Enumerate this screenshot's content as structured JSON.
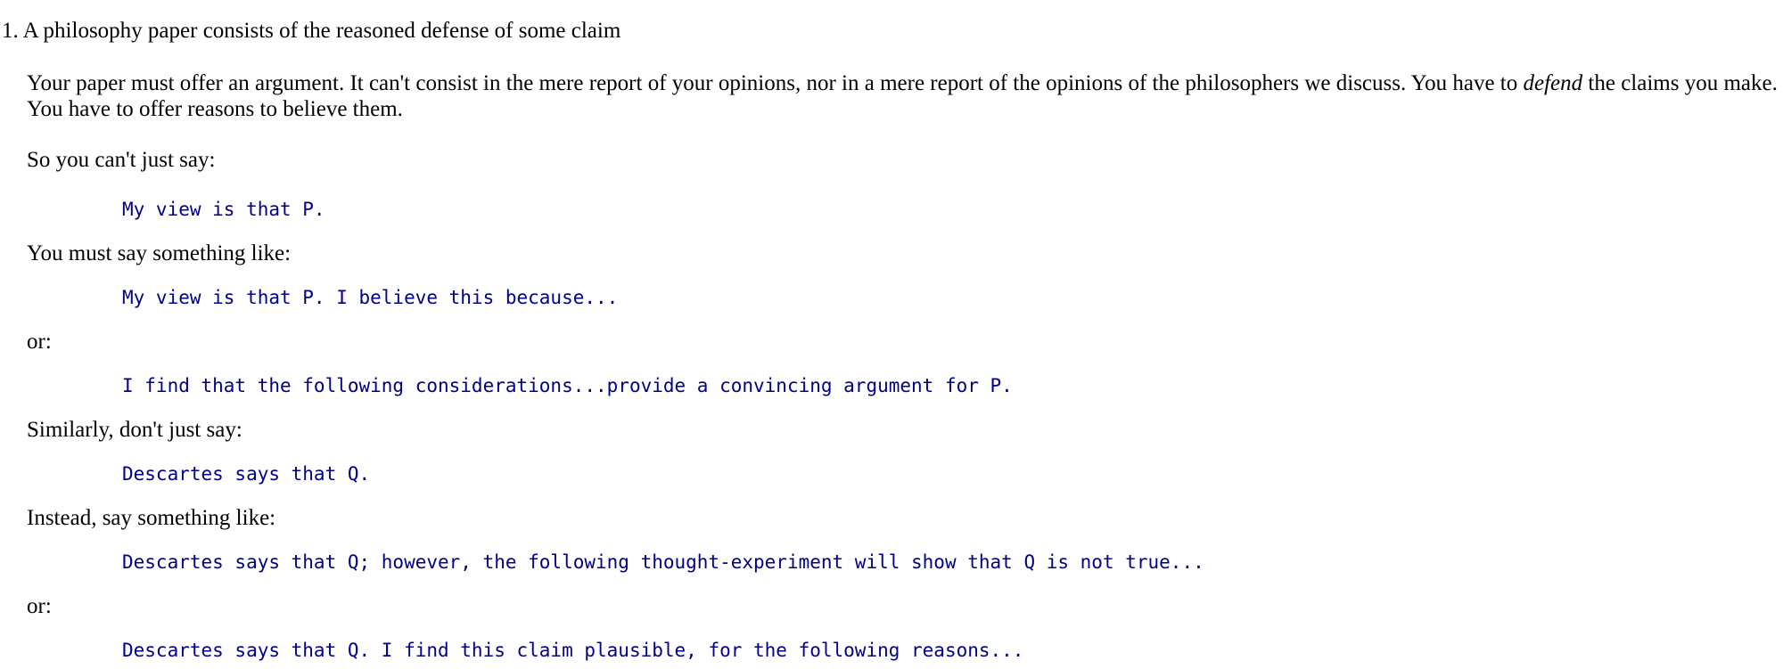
{
  "item": {
    "number": "1.",
    "title": "A philosophy paper consists of the reasoned defense of some claim"
  },
  "intro": {
    "part1": "Your paper must offer an argument. It can't consist in the mere report of your opinions, nor in a mere report of the opinions of the philosophers we discuss. You have to ",
    "emphasis": "defend",
    "part2": " the claims you make. You have to offer reasons to believe them."
  },
  "lines": {
    "cant_say": "So you can't just say:",
    "example1": "My view is that P.",
    "must_say": "You must say something like:",
    "example2": "My view is that P. I believe this because...",
    "or1": "or:",
    "example3": "I find that the following considerations...provide a convincing argument for P.",
    "similarly": "Similarly, don't just say:",
    "example4": "Descartes says that Q.",
    "instead": "Instead, say something like:",
    "example5": "Descartes says that Q; however, the following thought-experiment will show that Q is not true...",
    "or2": "or:",
    "example6": "Descartes says that Q. I find this claim plausible, for the following reasons..."
  }
}
